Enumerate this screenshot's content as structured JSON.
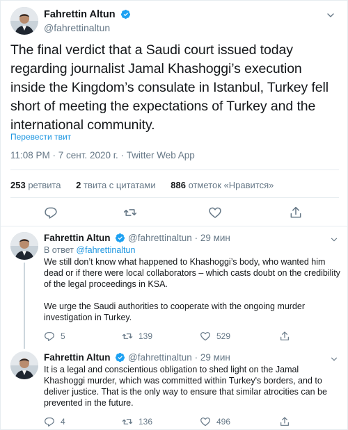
{
  "main_tweet": {
    "name": "Fahrettin Altun",
    "handle": "@fahrettinaltun",
    "text": "The final verdict that a Saudi court issued today regarding journalist Jamal Khashoggi’s execution inside the Kingdom’s consulate in Istanbul, Turkey fell short of meeting the expectations of Turkey and the international community.",
    "translate_label": "Перевести твит",
    "meta": "11:08 PM · 7 сент. 2020 г. · Twitter Web App",
    "stats": {
      "retweets_count": "253",
      "retweets_label": "ретвита",
      "quotes_count": "2",
      "quotes_label": "твита с цитатами",
      "likes_count": "886",
      "likes_label": "отметок «Нравится»"
    },
    "action_icons": [
      "reply-icon",
      "retweet-icon",
      "like-icon",
      "share-icon"
    ]
  },
  "replies": [
    {
      "name": "Fahrettin Altun",
      "handle": "@fahrettinaltun",
      "sep": "·",
      "time": "29 мин",
      "reply_to_prefix": "В ответ",
      "reply_to_handle": "@fahrettinaltun",
      "paragraphs": [
        "We still don’t know what happened to Khashoggi’s body, who wanted him dead or if there were local collaborators – which casts doubt on the credibility of the legal proceedings in KSA.",
        "We urge the Saudi authorities to cooperate with the ongoing murder investigation in Turkey."
      ],
      "reply_count": "5",
      "retweet_count": "139",
      "like_count": "529"
    },
    {
      "name": "Fahrettin Altun",
      "handle": "@fahrettinaltun",
      "sep": "·",
      "time": "29 мин",
      "paragraphs": [
        "It is a legal and conscientious obligation to shed light on the Jamal Khashoggi murder, which was committed within Turkey's borders, and to deliver justice. That is the only way to ensure that similar atrocities can be prevented in the future."
      ],
      "reply_count": "4",
      "retweet_count": "136",
      "like_count": "496"
    }
  ],
  "colors": {
    "accent": "#1b95e0",
    "verified": "#1da1f2",
    "text": "#14171a",
    "muted": "#657786",
    "divider": "#e6ecf0"
  }
}
